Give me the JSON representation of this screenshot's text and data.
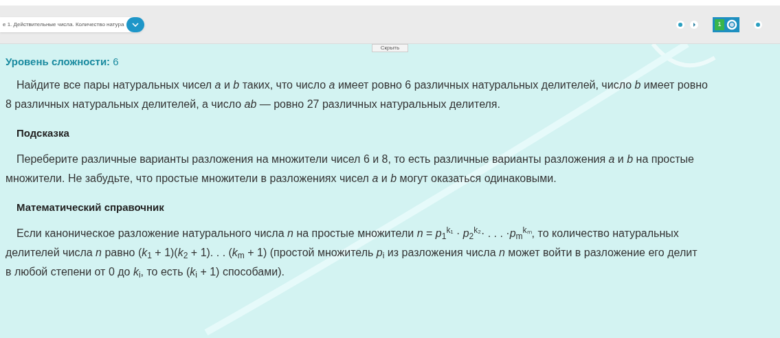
{
  "toolbar": {
    "breadcrumb": "е 1. Действительные числа. Количество натура",
    "badge": "1"
  },
  "hide_button": "Скрыть",
  "difficulty": {
    "label": "Уровень сложности:",
    "value": "6"
  },
  "sections": [
    {
      "kind": "paragraph",
      "lines": [
        "Найдите все пары натуральных чисел *a* и *b* таких, что число *a* имеет ровно 6 различных натуральных делителей, число *b* имеет ровно",
        "8 различных натуральных делителей, а число *ab* — ровно 27 различных натуральных делителя."
      ]
    },
    {
      "kind": "heading",
      "text": "Подсказка"
    },
    {
      "kind": "paragraph",
      "lines": [
        "Переберите различные варианты разложения на множители чисел 6 и 8, то есть различные варианты разложения *a* и *b* на простые",
        "множители. Не забудьте, что простые множители в разложениях чисел *a* и *b* могут оказаться одинаковыми."
      ]
    },
    {
      "kind": "heading",
      "text": "Математический справочник"
    },
    {
      "kind": "paragraph",
      "lines": [
        "Если каноническое разложение натурального числа *n* на простые множители *n* = *p*$_{1}$$^{k₁}$ · *p*$_{2}$$^{k₂}$· . . . ·*p*$_{m}$$^{kₘ}$, то количество натуральных",
        "делителей числа *n* равно (*k*$_{1}$ + 1)(*k*$_{2}$ + 1). . . (*k*$_{m}$ + 1) (простой множитель *p*$_{i}$ из разложения числа *n* может войти в разложение его делит",
        "в любой степени от 0 до *k*$_{i}$, то есть (*k*$_{i}$ + 1) способами)."
      ]
    }
  ]
}
